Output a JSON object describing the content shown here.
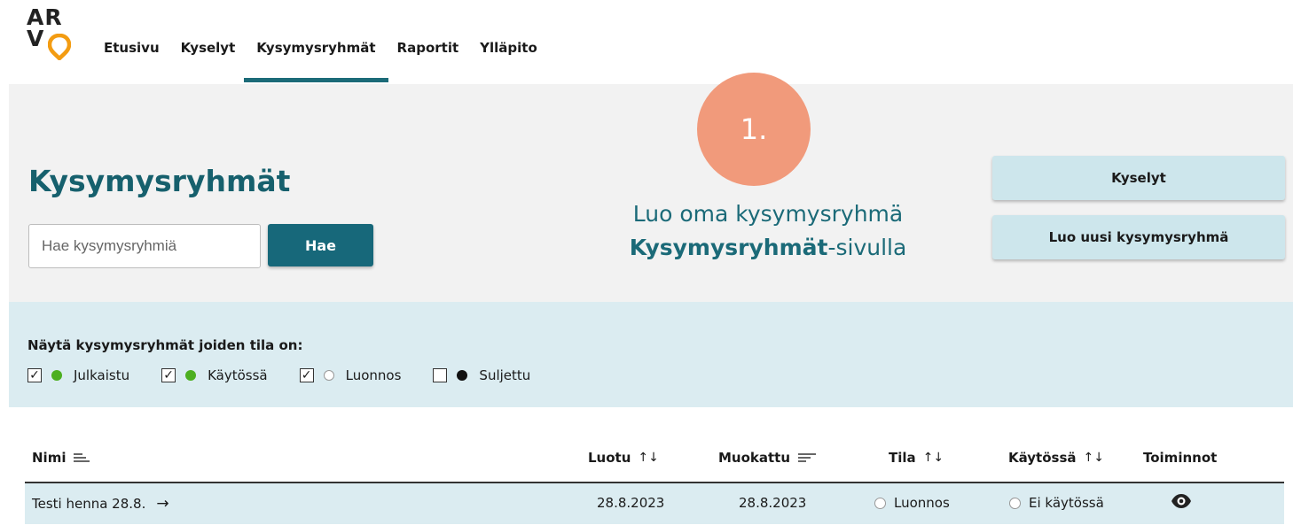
{
  "logo": {
    "line1": "AR",
    "line2": "V"
  },
  "nav": {
    "items": [
      "Etusivu",
      "Kyselyt",
      "Kysymysryhmät",
      "Raportit",
      "Ylläpito"
    ],
    "active": "Kysymysryhmät"
  },
  "page": {
    "title": "Kysymysryhmät"
  },
  "search": {
    "placeholder": "Hae kysymysryhmiä",
    "button": "Hae"
  },
  "callout": {
    "step": "1.",
    "line1": "Luo oma kysymysryhmä",
    "line2_bold": "Kysymysryhmät",
    "line2_rest": "-sivulla"
  },
  "actions": {
    "kyselyt": "Kyselyt",
    "create": "Luo uusi kysymysryhmä"
  },
  "filter": {
    "title": "Näytä kysymysryhmät joiden tila on:",
    "options": [
      {
        "label": "Julkaistu",
        "checked": true,
        "dot": "green"
      },
      {
        "label": "Käytössä",
        "checked": true,
        "dot": "green"
      },
      {
        "label": "Luonnos",
        "checked": true,
        "dot": "empty"
      },
      {
        "label": "Suljettu",
        "checked": false,
        "dot": "black"
      }
    ]
  },
  "table": {
    "columns": {
      "name": "Nimi",
      "created": "Luotu",
      "modified": "Muokattu",
      "status": "Tila",
      "in_use": "Käytössä",
      "actions": "Toiminnot"
    },
    "rows": [
      {
        "name": "Testi henna 28.8.",
        "created": "28.8.2023",
        "modified": "28.8.2023",
        "status": "Luonnos",
        "in_use": "Ei käytössä"
      }
    ]
  },
  "colors": {
    "brand_teal": "#17687a",
    "accent_orange": "#f19a7b",
    "filter_bg": "#dbecf1",
    "button_light": "#cde6ec"
  }
}
